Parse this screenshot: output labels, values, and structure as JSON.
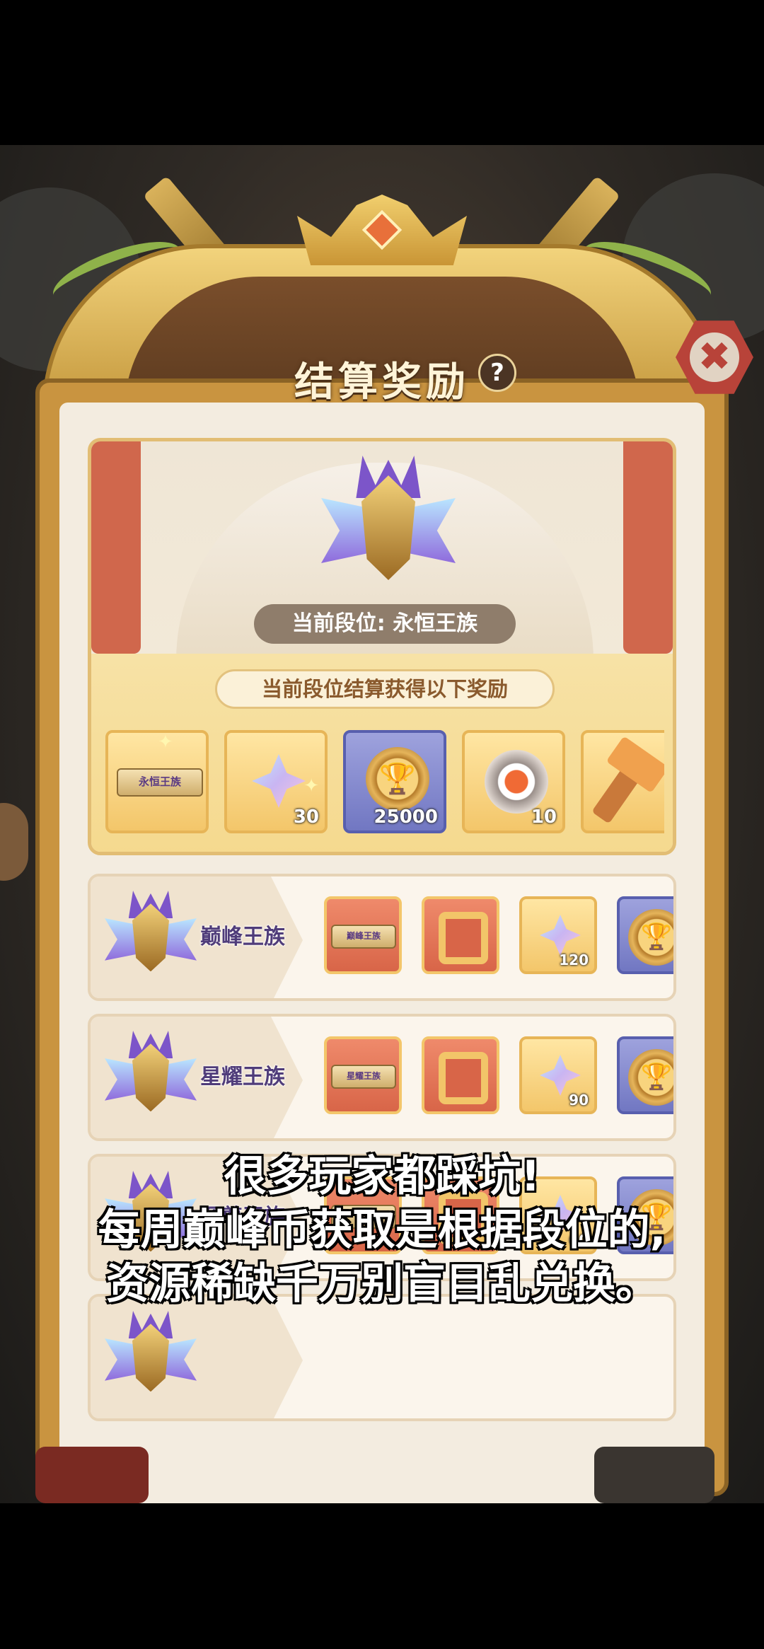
{
  "header": {
    "title": "结算奖励",
    "help_label": "?",
    "close_label": "✖"
  },
  "current": {
    "rank_label": "当前段位: 永恒王族",
    "band_title": "当前段位结算获得以下奖励",
    "rewards": [
      {
        "icon": "rank-plate",
        "plate_text": "永恒王族",
        "qty": ""
      },
      {
        "icon": "crystal",
        "qty": "30"
      },
      {
        "icon": "trophy-coin",
        "qty": "25000"
      },
      {
        "icon": "gear-coin",
        "qty": "10"
      },
      {
        "icon": "hammer",
        "qty": ""
      }
    ]
  },
  "tiers": [
    {
      "name": "巅峰王族",
      "plate_text": "巅峰王族",
      "crystal_qty": "120"
    },
    {
      "name": "星耀王族",
      "plate_text": "星耀王族",
      "crystal_qty": "90"
    },
    {
      "name": "至尊王族",
      "plate_text": "王族",
      "crystal_qty": "60"
    }
  ],
  "caption": {
    "line1": "很多玩家都踩坑!",
    "line2": "每周巅峰币获取是根据段位的,",
    "line3": "资源稀缺千万别盲目乱兑换。"
  },
  "colors": {
    "panel_gold": "#c99440",
    "tier_name": "#4f3c7a",
    "close_red": "#b84339"
  }
}
